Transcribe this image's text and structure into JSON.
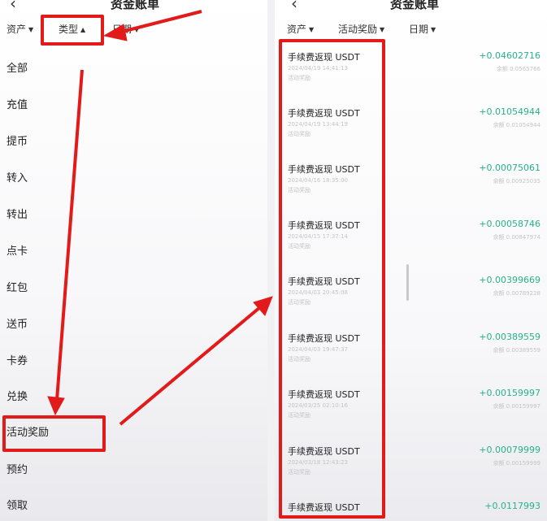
{
  "left": {
    "back_glyph": "‹",
    "title": "资金账单",
    "filters": [
      {
        "label": "资产",
        "caret": "▼"
      },
      {
        "label": "类型",
        "caret": "▲"
      },
      {
        "label": "日期",
        "caret": "▼"
      }
    ],
    "menu": [
      "全部",
      "充值",
      "提币",
      "转入",
      "转出",
      "点卡",
      "红包",
      "送币",
      "卡券",
      "兑换",
      "活动奖励",
      "预约",
      "领取"
    ]
  },
  "right": {
    "back_glyph": "‹",
    "title": "资金账单",
    "filters": [
      {
        "label": "资产",
        "caret": "▼"
      },
      {
        "label": "活动奖励",
        "caret": "▼"
      },
      {
        "label": "日期",
        "caret": "▼"
      }
    ],
    "rows": [
      {
        "title": "手续费返现 USDT",
        "time": "2024/04/19 14:41:13",
        "tag": "活动奖励",
        "amount": "+0.04602716",
        "balance": "余额 0.0565766"
      },
      {
        "title": "手续费返现 USDT",
        "time": "2024/04/19 13:44:19",
        "tag": "活动奖励",
        "amount": "+0.01054944",
        "balance": "余额 0.01054944"
      },
      {
        "title": "手续费返现 USDT",
        "time": "2024/04/16 18:35:00",
        "tag": "活动奖励",
        "amount": "+0.00075061",
        "balance": "余额 0.00925035"
      },
      {
        "title": "手续费返现 USDT",
        "time": "2024/04/15 17:37:14",
        "tag": "活动奖励",
        "amount": "+0.00058746",
        "balance": "余额 0.00847974"
      },
      {
        "title": "手续费返现 USDT",
        "time": "2024/04/03 20:45:08",
        "tag": "活动奖励",
        "amount": "+0.00399669",
        "balance": "余额 0.00789228"
      },
      {
        "title": "手续费返现 USDT",
        "time": "2024/04/03 19:47:37",
        "tag": "活动奖励",
        "amount": "+0.00389559",
        "balance": "余额 0.00389559"
      },
      {
        "title": "手续费返现 USDT",
        "time": "2024/03/25 02:10:16",
        "tag": "活动奖励",
        "amount": "+0.00159997",
        "balance": "余额 0.00159997"
      },
      {
        "title": "手续费返现 USDT",
        "time": "2024/03/18 12:43:23",
        "tag": "活动奖励",
        "amount": "+0.00079999",
        "balance": "余额 0.00159999"
      },
      {
        "title": "手续费返现 USDT",
        "time": "",
        "tag": "",
        "amount": "+0.0117993",
        "balance": ""
      }
    ]
  },
  "colors": {
    "highlight": "#e21a1a",
    "amount_green": "#27b28a",
    "muted_text": "#c4c4c4"
  }
}
